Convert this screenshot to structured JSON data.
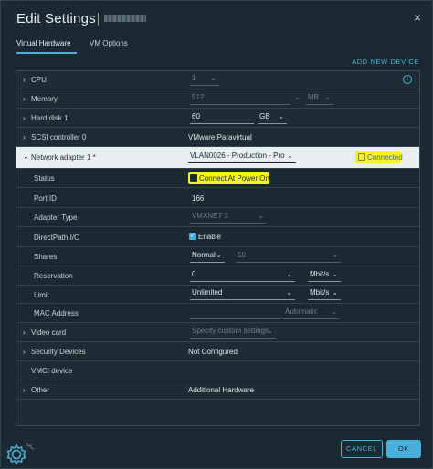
{
  "dialog": {
    "title": "Edit Settings",
    "close_symbol": "×"
  },
  "tabs": [
    {
      "label": "Virtual Hardware",
      "active": true
    },
    {
      "label": "VM Options",
      "active": false
    }
  ],
  "add_device_label": "ADD NEW DEVICE",
  "hardware": {
    "cpu": {
      "label": "CPU",
      "value": "1"
    },
    "memory": {
      "label": "Memory",
      "value": "512",
      "unit": "MB"
    },
    "hard_disk": {
      "label": "Hard disk 1",
      "value": "60",
      "unit": "GB"
    },
    "scsi": {
      "label": "SCSI controller 0",
      "value": "VMware Paravirtual"
    },
    "network": {
      "label": "Network adapter 1 *",
      "value": "VLAN0026 - Production - Pro",
      "connected_label": "Connected",
      "status_label": "Status",
      "connect_power_label": "Connect At Power On",
      "port_id_label": "Port ID",
      "port_id_value": "166",
      "adapter_type_label": "Adapter Type",
      "adapter_type_value": "VMXNET 3",
      "directpath_label": "DirectPath I/O",
      "directpath_value": "Enable",
      "shares_label": "Shares",
      "shares_level": "Normal",
      "shares_value": "50",
      "reservation_label": "Reservation",
      "reservation_value": "0",
      "reservation_unit": "Mbit/s",
      "limit_label": "Limit",
      "limit_value": "Unlimited",
      "limit_unit": "Mbit/s",
      "mac_label": "MAC Address",
      "mac_mode": "Automatic"
    },
    "video": {
      "label": "Video card",
      "value": "Specify custom settings"
    },
    "security": {
      "label": "Security Devices",
      "value": "Not Configured"
    },
    "vmci": {
      "label": "VMCI device"
    },
    "other": {
      "label": "Other",
      "value": "Additional Hardware"
    }
  },
  "buttons": {
    "cancel": "CANCEL",
    "ok": "OK"
  },
  "colors": {
    "accent": "#49afd9",
    "highlight": "#f4f225",
    "background": "#1b2a32"
  },
  "icons": {
    "info": "i",
    "gear": "gear-icon"
  }
}
